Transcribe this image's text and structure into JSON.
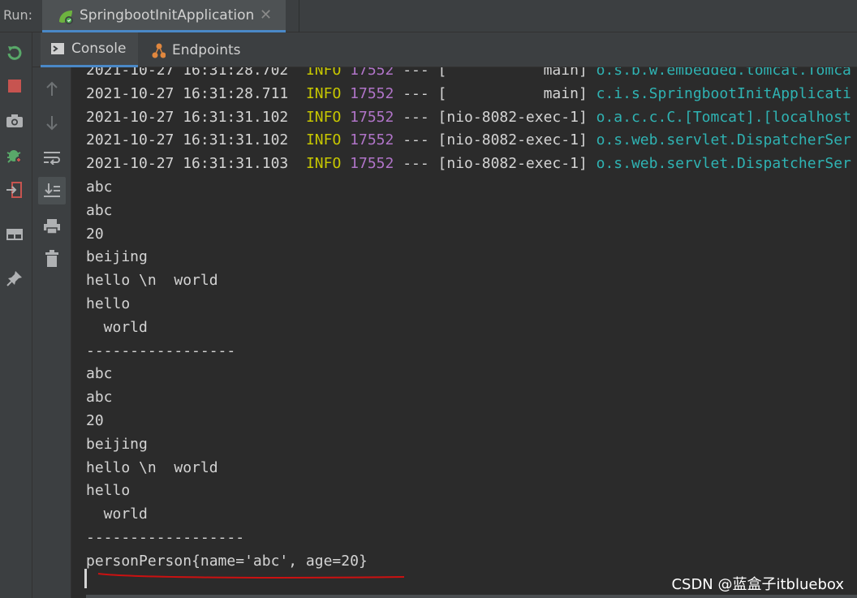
{
  "run_panel": {
    "label": "Run:",
    "tab_title": "SpringbootInitApplication",
    "close_glyph": "✕"
  },
  "subtabs": [
    {
      "label": "Console",
      "icon": "console-icon",
      "active": true
    },
    {
      "label": "Endpoints",
      "icon": "endpoints-icon",
      "active": false
    }
  ],
  "left_toolbar": [
    "rerun-icon",
    "stop-icon",
    "camera-icon",
    "debug-bug-icon",
    "exit-icon",
    "layout-icon",
    "pin-icon"
  ],
  "console_toolbar": [
    "up-arrow-icon",
    "down-arrow-icon",
    "soft-wrap-icon",
    "scroll-to-end-icon",
    "print-icon",
    "clear-icon"
  ],
  "log_rows": [
    {
      "date": "2021-10-27",
      "time": "16:31:28.702",
      "level": "INFO",
      "pid": "17552",
      "sep": "---",
      "thread": "[           main]",
      "logger": "o.s.b.w.embedded.tomcat.Tomca"
    },
    {
      "date": "2021-10-27",
      "time": "16:31:28.711",
      "level": "INFO",
      "pid": "17552",
      "sep": "---",
      "thread": "[           main]",
      "logger": "c.i.s.SpringbootInitApplicati"
    },
    {
      "date": "2021-10-27",
      "time": "16:31:31.102",
      "level": "INFO",
      "pid": "17552",
      "sep": "---",
      "thread": "[nio-8082-exec-1]",
      "logger": "o.a.c.c.C.[Tomcat].[localhost"
    },
    {
      "date": "2021-10-27",
      "time": "16:31:31.102",
      "level": "INFO",
      "pid": "17552",
      "sep": "---",
      "thread": "[nio-8082-exec-1]",
      "logger": "o.s.web.servlet.DispatcherSer"
    },
    {
      "date": "2021-10-27",
      "time": "16:31:31.103",
      "level": "INFO",
      "pid": "17552",
      "sep": "---",
      "thread": "[nio-8082-exec-1]",
      "logger": "o.s.web.servlet.DispatcherSer"
    }
  ],
  "output_lines": [
    "abc",
    "abc",
    "20",
    "beijing",
    "hello \\n  world",
    "hello",
    "  world",
    "-----------------",
    "abc",
    "abc",
    "20",
    "beijing",
    "hello \\n  world",
    "hello",
    "  world",
    "------------------",
    "personPerson{name='abc', age=20}"
  ],
  "watermark": "CSDN @蓝盒子itbluebox",
  "colors": {
    "info": "#c7c700",
    "pid": "#b074c8",
    "logger": "#2fb3b3",
    "annotation": "#cc1111",
    "accent": "#4a88c7"
  }
}
